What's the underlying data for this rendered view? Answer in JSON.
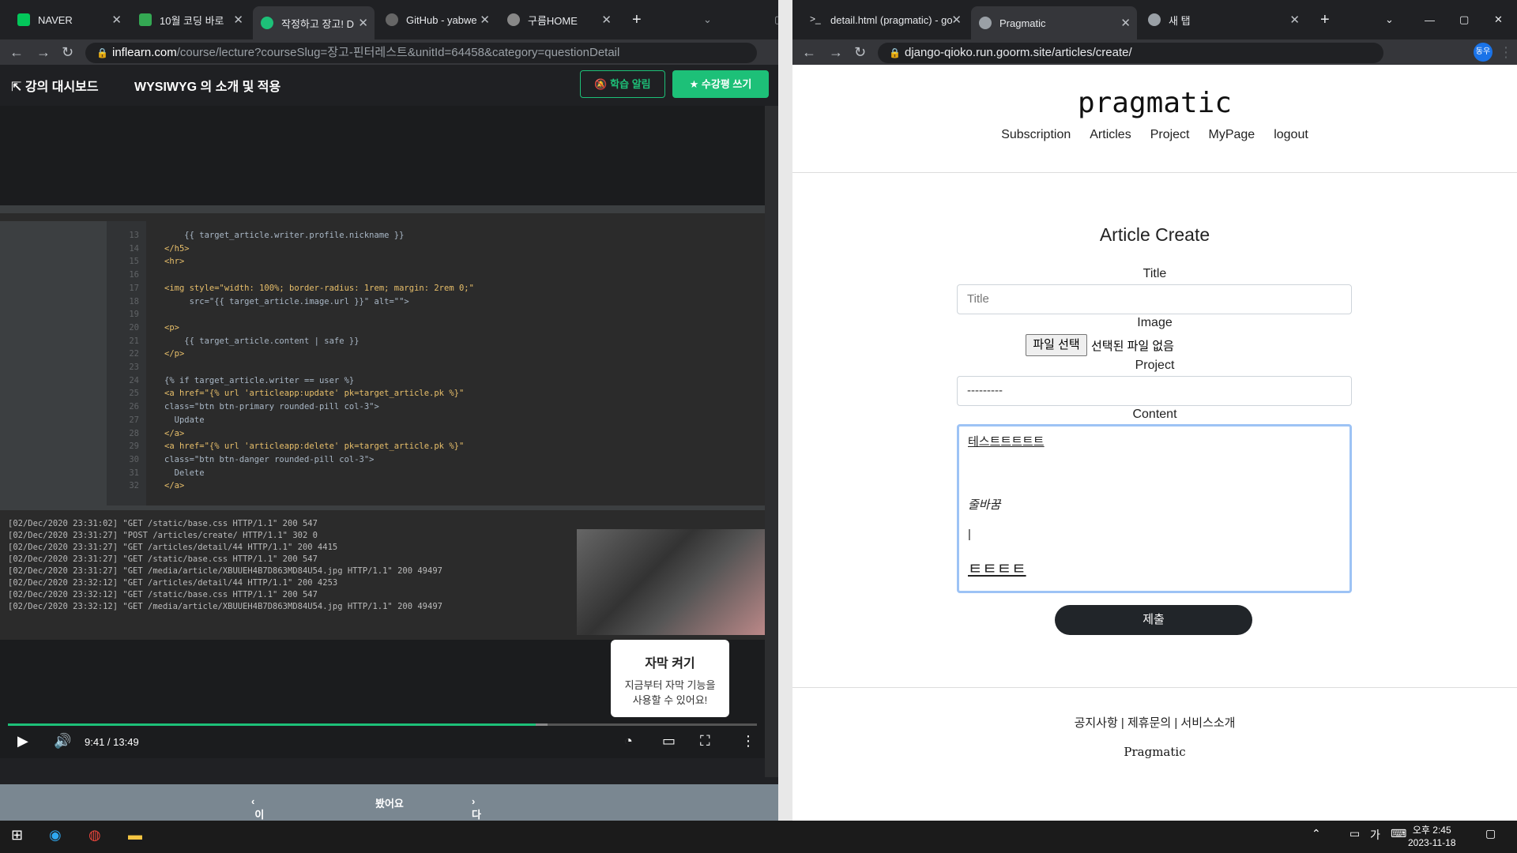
{
  "left_browser": {
    "tabs": [
      {
        "label": "NAVER",
        "favicon": "naver-icon",
        "favcolor": "#03c75a"
      },
      {
        "label": "10월 코딩 바로",
        "favicon": "mail-icon",
        "favcolor": "#34a853"
      },
      {
        "label": "작정하고 장고! D",
        "favicon": "inflearn-icon",
        "favcolor": "#1dc078"
      },
      {
        "label": "GitHub - yabwe",
        "favicon": "github-icon",
        "favcolor": "#666"
      },
      {
        "label": "구름HOME",
        "favicon": "cloud-icon",
        "favcolor": "#888"
      }
    ],
    "url_host": "inflearn.com",
    "url_path": "/course/lecture?courseSlug=장고-핀터레스트&unitId=64458&category=questionDetail"
  },
  "inflearn": {
    "dashboard": "강의 대시보드",
    "lecture_title": "WYSIWYG 의 소개 및 적용",
    "notify_btn": "학습 알림",
    "review_btn": "수강평 쓰기",
    "caption_title": "자막 켜기",
    "caption_line1": "지금부터 자막 기능을",
    "caption_line2": "사용할 수 있어요!",
    "time": "9:41 / 13:49",
    "progress": 0.705,
    "buffer": 0.72,
    "prev": "이전 수업",
    "done": "봤어요",
    "next": "다음 수업"
  },
  "code_lines": [
    [
      "13",
      "    {{ target_article.writer.profile.nickname }}"
    ],
    [
      "14",
      "</h5>"
    ],
    [
      "15",
      "<hr>"
    ],
    [
      "16",
      ""
    ],
    [
      "17",
      "<img style=\"width: 100%; border-radius: 1rem; margin: 2rem 0;\""
    ],
    [
      "18",
      "     src=\"{{ target_article.image.url }}\" alt=\"\">"
    ],
    [
      "19",
      ""
    ],
    [
      "20",
      "<p>"
    ],
    [
      "21",
      "    {{ target_article.content | safe }}"
    ],
    [
      "22",
      "</p>"
    ],
    [
      "23",
      ""
    ],
    [
      "24",
      "{% if target_article.writer == user %}"
    ],
    [
      "25",
      "<a href=\"{% url 'articleapp:update' pk=target_article.pk %}\""
    ],
    [
      "26",
      "class=\"btn btn-primary rounded-pill col-3\">"
    ],
    [
      "27",
      "  Update"
    ],
    [
      "28",
      "</a>"
    ],
    [
      "29",
      "<a href=\"{% url 'articleapp:delete' pk=target_article.pk %}\""
    ],
    [
      "30",
      "class=\"btn btn-danger rounded-pill col-3\">"
    ],
    [
      "31",
      "  Delete"
    ],
    [
      "32",
      "</a>"
    ]
  ],
  "terminal": [
    "[02/Dec/2020 23:31:02] \"GET /static/base.css HTTP/1.1\" 200 547",
    "[02/Dec/2020 23:31:27] \"POST /articles/create/ HTTP/1.1\" 302 0",
    "[02/Dec/2020 23:31:27] \"GET /articles/detail/44 HTTP/1.1\" 200 4415",
    "[02/Dec/2020 23:31:27] \"GET /static/base.css HTTP/1.1\" 200 547",
    "[02/Dec/2020 23:31:27] \"GET /media/article/XBUUEH4B7D863MD84U54.jpg HTTP/1.1\" 200 49497",
    "[02/Dec/2020 23:32:12] \"GET /articles/detail/44 HTTP/1.1\" 200 4253",
    "[02/Dec/2020 23:32:12] \"GET /static/base.css HTTP/1.1\" 200 547",
    "[02/Dec/2020 23:32:12] \"GET /media/article/XBUUEH4B7D863MD84U54.jpg HTTP/1.1\" 200 49497"
  ],
  "right_browser": {
    "tabs": [
      {
        "label": "detail.html (pragmatic) - go"
      },
      {
        "label": "Pragmatic"
      },
      {
        "label": "새 탭"
      }
    ],
    "url": "django-qioko.run.goorm.site/articles/create/",
    "profile": "동우"
  },
  "site": {
    "brand": "pragmatic",
    "nav": [
      "Subscription",
      "Articles",
      "Project",
      "MyPage",
      "logout"
    ],
    "heading": "Article Create",
    "title_label": "Title",
    "title_placeholder": "Title",
    "image_label": "Image",
    "file_button": "파일 선택",
    "file_status": "선택된 파일 없음",
    "project_label": "Project",
    "project_value": "---------",
    "content_label": "Content",
    "content_lines": [
      "테스트트트트트",
      "줄바꿈",
      "|",
      "ㅌㅌㅌㅌ"
    ],
    "submit": "제출",
    "footer_links": "공지사항 | 제휴문의 | 서비스소개",
    "footer_brand": "Pragmatic"
  },
  "taskbar": {
    "time": "오후 2:45",
    "date": "2023-11-18",
    "ime": "가"
  }
}
